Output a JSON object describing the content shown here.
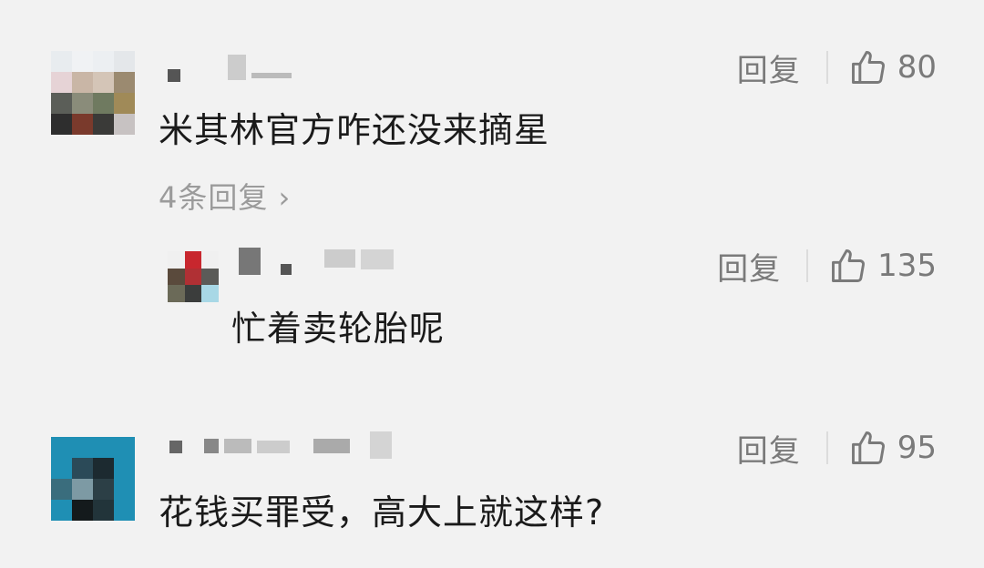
{
  "comments": [
    {
      "content": "米其林官方咋还没来摘星",
      "reply_label": "回复",
      "likes": "80",
      "more_replies": "4条回复 ›"
    },
    {
      "content": "忙着卖轮胎呢",
      "reply_label": "回复",
      "likes": "135"
    },
    {
      "content": "花钱买罪受，高大上就这样?",
      "reply_label": "回复",
      "likes": "95"
    }
  ],
  "colors": {
    "background": "#f2f2f2",
    "meta_text": "#7a7a7a",
    "body_text": "#1a1a1a",
    "link_text": "#9b9b9b"
  },
  "icons": [
    "thumbs-up-icon"
  ]
}
